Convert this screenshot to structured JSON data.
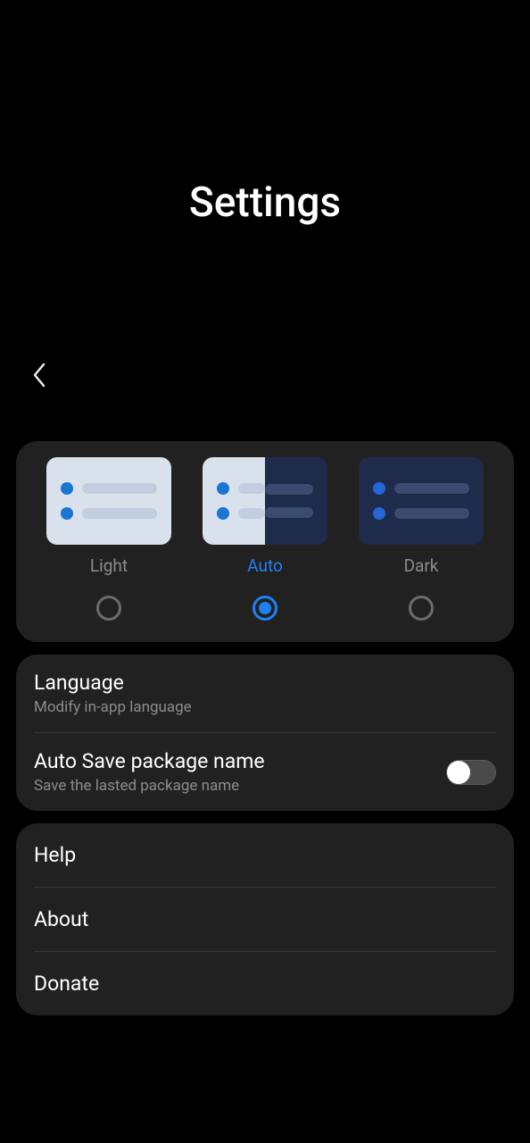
{
  "header": {
    "title": "Settings"
  },
  "theme": {
    "options": [
      {
        "label": "Light",
        "selected": false
      },
      {
        "label": "Auto",
        "selected": true
      },
      {
        "label": "Dark",
        "selected": false
      }
    ]
  },
  "settings_group1": {
    "language": {
      "title": "Language",
      "subtitle": "Modify in-app language"
    },
    "autosave": {
      "title": "Auto Save package name",
      "subtitle": "Save the lasted package name",
      "enabled": false
    }
  },
  "settings_group2": {
    "help": {
      "title": "Help"
    },
    "about": {
      "title": "About"
    },
    "donate": {
      "title": "Donate"
    }
  },
  "colors": {
    "accent": "#2080f7"
  }
}
